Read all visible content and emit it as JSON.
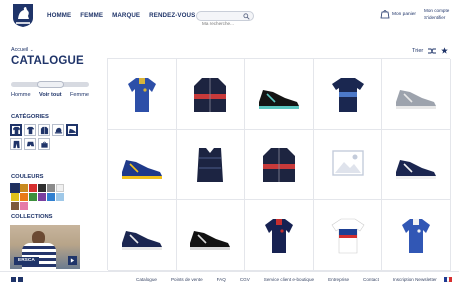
{
  "header": {
    "nav": [
      "HOMME",
      "FEMME",
      "MARQUE",
      "RENDEZ-VOUS"
    ],
    "search_placeholder": "Ma recherche...",
    "cart_label": "Mon panier",
    "account_label": "Mon compte",
    "login_label": "S'identifier"
  },
  "sidebar": {
    "breadcrumb": "Accueil",
    "title": "CATALOGUE",
    "gender": {
      "options": [
        "Homme",
        "Voir tout",
        "Femme"
      ],
      "selected": "Voir tout"
    },
    "categories_title": "CATÉGORIES",
    "categories": [
      {
        "icon": "polo-icon",
        "selected": true
      },
      {
        "icon": "tshirt-icon",
        "selected": false
      },
      {
        "icon": "jacket-icon",
        "selected": false
      },
      {
        "icon": "cap-icon",
        "selected": false
      },
      {
        "icon": "sneaker-icon",
        "selected": true
      },
      {
        "icon": "pants-icon",
        "selected": false
      },
      {
        "icon": "shorts-icon",
        "selected": false
      },
      {
        "icon": "bag-icon",
        "selected": false
      }
    ],
    "colors_title": "COULEURS",
    "colors": [
      "#1f2f5c",
      "#c98a1f",
      "#d62f2f",
      "#2e2e2e",
      "#8a8a8a",
      "#f0f0f0",
      "#e0c21a",
      "#e97a18",
      "#3c8f3c",
      "#7a3fa0",
      "#2f7fd0",
      "#9fc8e8",
      "#7d5a3b",
      "#e67aa8"
    ],
    "collections_title": "COLLECTIONS",
    "collection_tag": "ERSCA"
  },
  "sort_label": "Trier",
  "products": [
    {
      "name": "polo-blue-icon",
      "colors": [
        "#2d4fa8",
        "#d8b43a"
      ]
    },
    {
      "name": "jacket-navy-red-icon",
      "colors": [
        "#1d2440",
        "#c83a3a"
      ]
    },
    {
      "name": "sneaker-black-teal-icon",
      "colors": [
        "#141414",
        "#5cc6c0"
      ]
    },
    {
      "name": "tee-navy-stripe-icon",
      "colors": [
        "#1a2750",
        "#4d79c8"
      ]
    },
    {
      "name": "sneaker-grey-icon",
      "colors": [
        "#9da3ad",
        "#e8e8e8"
      ]
    },
    {
      "name": "sneaker-blue-yellow-icon",
      "colors": [
        "#1f3a8a",
        "#f2c21b"
      ]
    },
    {
      "name": "vest-navy-icon",
      "colors": [
        "#1c2442",
        "#3d4a72"
      ]
    },
    {
      "name": "jacket-navy-red-2-icon",
      "colors": [
        "#1d2440",
        "#c83a3a"
      ]
    },
    {
      "name": "image-placeholder-icon",
      "colors": [
        "#dfe3ec",
        "#c4ccdb"
      ]
    },
    {
      "name": "sneaker-navy-white-icon",
      "colors": [
        "#1b2650",
        "#f2f2f2"
      ]
    },
    {
      "name": "sneaker-navy-low-icon",
      "colors": [
        "#1b2650",
        "#e9e9e9"
      ]
    },
    {
      "name": "sneaker-black-low-icon",
      "colors": [
        "#111111",
        "#d9d9d9"
      ]
    },
    {
      "name": "polo-navy-icon",
      "colors": [
        "#172252",
        "#c62f2f"
      ]
    },
    {
      "name": "jersey-tricolore-icon",
      "colors": [
        "#1d3f93",
        "#d32f2f"
      ]
    },
    {
      "name": "polo-royal-icon",
      "colors": [
        "#3157b5",
        "#f2f2f2"
      ]
    }
  ],
  "footer": {
    "links": [
      "Catalogue",
      "Points de vente",
      "FAQ",
      "CGV",
      "Service client e-boutique",
      "Entreprise",
      "Contact",
      "Inscription Newsletter"
    ]
  }
}
